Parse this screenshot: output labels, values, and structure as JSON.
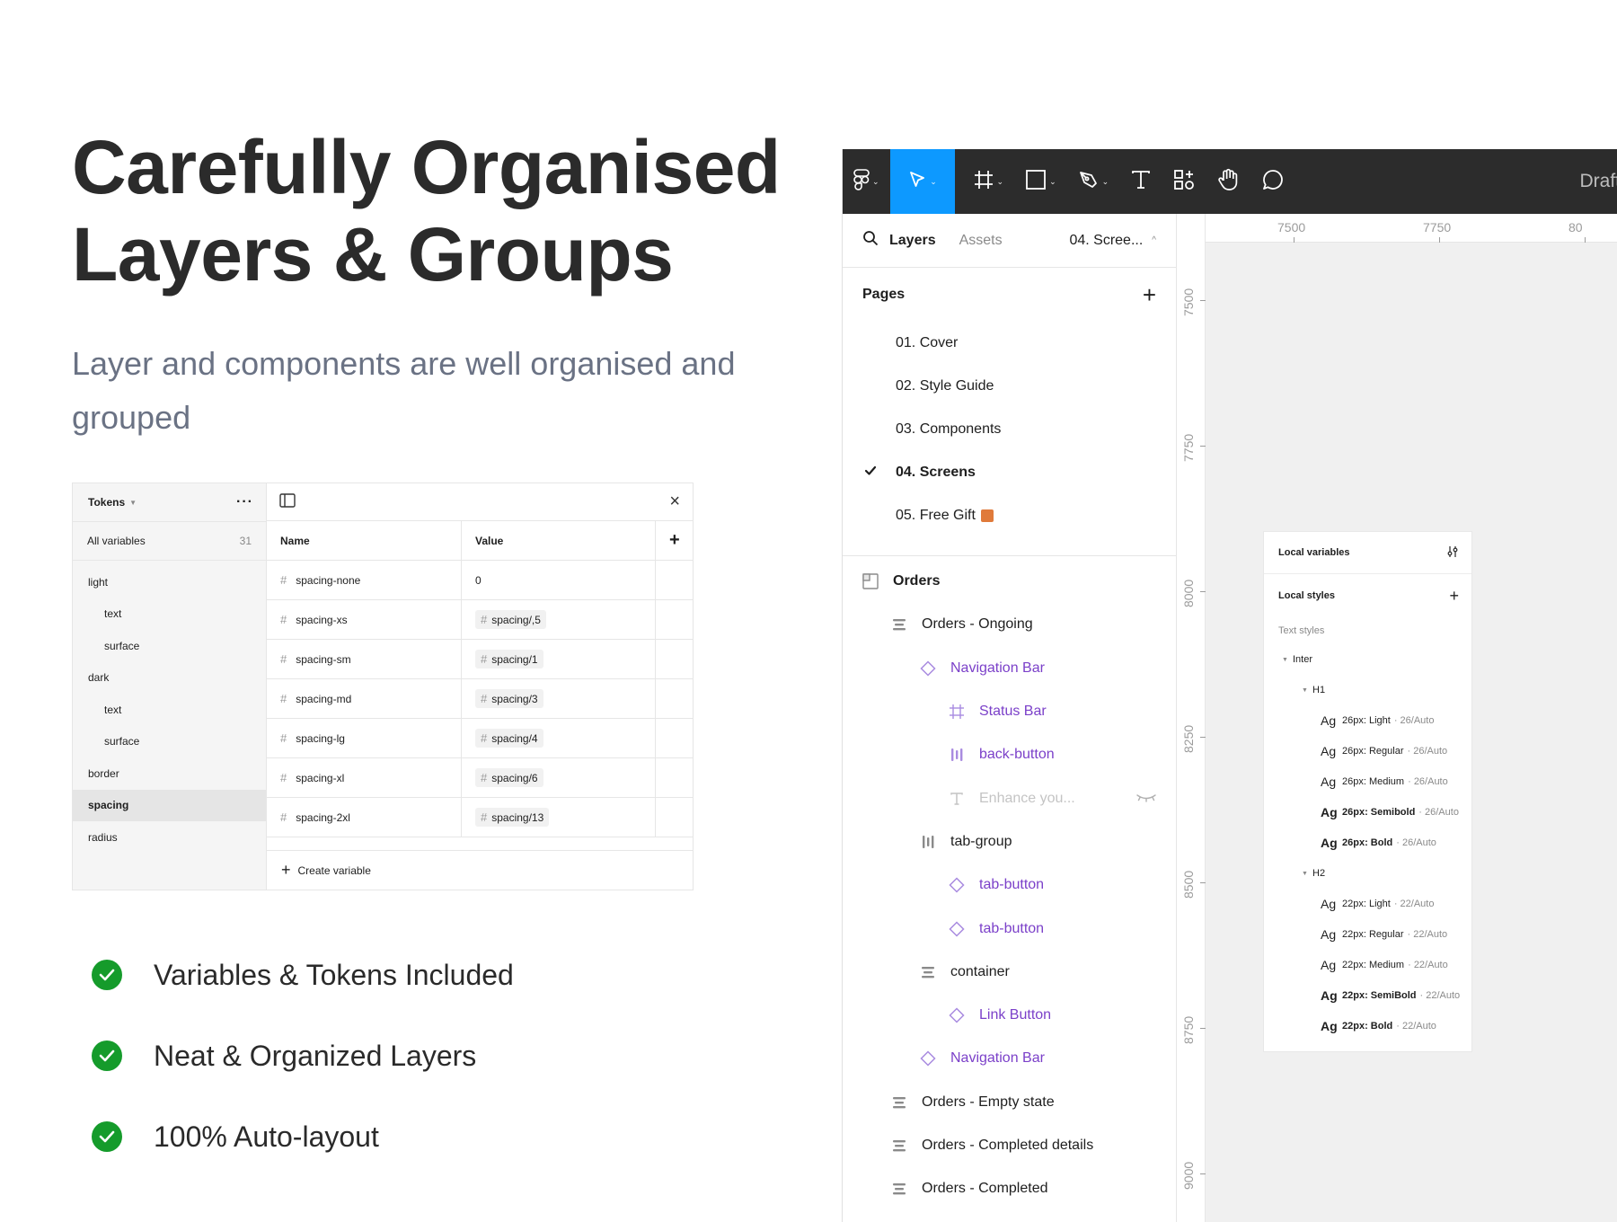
{
  "headline": {
    "line1": "Carefully Organised",
    "line2": "Layers & Groups"
  },
  "subline": "Layer and components are well organised and grouped",
  "tokens_panel": {
    "collection": "Tokens",
    "all_variables_label": "All variables",
    "all_variables_count": "31",
    "groups": [
      {
        "label": "light",
        "level": 0
      },
      {
        "label": "text",
        "level": 1
      },
      {
        "label": "surface",
        "level": 1
      },
      {
        "label": "dark",
        "level": 0
      },
      {
        "label": "text",
        "level": 1
      },
      {
        "label": "surface",
        "level": 1
      },
      {
        "label": "border",
        "level": 0
      },
      {
        "label": "spacing",
        "level": 0,
        "active": true
      },
      {
        "label": "radius",
        "level": 0
      }
    ],
    "columns": {
      "name": "Name",
      "value": "Value"
    },
    "rows": [
      {
        "name": "spacing-none",
        "value": "0",
        "alias": false
      },
      {
        "name": "spacing-xs",
        "value": "spacing/,5",
        "alias": true
      },
      {
        "name": "spacing-sm",
        "value": "spacing/1",
        "alias": true
      },
      {
        "name": "spacing-md",
        "value": "spacing/3",
        "alias": true
      },
      {
        "name": "spacing-lg",
        "value": "spacing/4",
        "alias": true
      },
      {
        "name": "spacing-xl",
        "value": "spacing/6",
        "alias": true
      },
      {
        "name": "spacing-2xl",
        "value": "spacing/13",
        "alias": true
      }
    ],
    "create_label": "Create variable"
  },
  "features": [
    "Variables & Tokens Included",
    "Neat & Organized Layers",
    "100% Auto-layout"
  ],
  "figma": {
    "toolbar_right_text": "Draft",
    "tools": [
      "figma-menu-icon",
      "move-icon",
      "frame-icon",
      "shape-icon",
      "pen-icon",
      "text-icon",
      "resources-icon",
      "hand-icon",
      "comment-icon"
    ],
    "tabs": {
      "layers": "Layers",
      "assets": "Assets",
      "current_page": "04. Scree..."
    },
    "pages_label": "Pages",
    "pages": [
      {
        "label": "01. Cover"
      },
      {
        "label": "02. Style Guide"
      },
      {
        "label": "03. Components"
      },
      {
        "label": "04. Screens",
        "current": true
      },
      {
        "label": "05. Free Gift"
      }
    ],
    "layers": [
      {
        "label": "Orders",
        "kind": "frame",
        "depth": 0
      },
      {
        "label": "Orders - Ongoing",
        "kind": "stack",
        "depth": 1
      },
      {
        "label": "Navigation Bar",
        "kind": "component",
        "depth": 2
      },
      {
        "label": "Status Bar",
        "kind": "component-frame",
        "depth": 3
      },
      {
        "label": "back-button",
        "kind": "component-hstack",
        "depth": 3
      },
      {
        "label": "Enhance you...",
        "kind": "text-hidden",
        "depth": 3
      },
      {
        "label": "tab-group",
        "kind": "hstack",
        "depth": 2
      },
      {
        "label": "tab-button",
        "kind": "component",
        "depth": 3
      },
      {
        "label": "tab-button",
        "kind": "component",
        "depth": 3
      },
      {
        "label": "container",
        "kind": "stack",
        "depth": 2
      },
      {
        "label": "Link Button",
        "kind": "component",
        "depth": 3
      },
      {
        "label": "Navigation Bar",
        "kind": "component",
        "depth": 2
      },
      {
        "label": "Orders - Empty state",
        "kind": "stack",
        "depth": 1
      },
      {
        "label": "Orders - Completed details",
        "kind": "stack",
        "depth": 1
      },
      {
        "label": "Orders - Completed",
        "kind": "stack",
        "depth": 1
      }
    ],
    "ruler_top": [
      "7500",
      "7750",
      "80"
    ],
    "ruler_left": [
      "7500",
      "7750",
      "8000",
      "8250",
      "8500",
      "8750",
      "9000"
    ],
    "local_panel": {
      "variables_label": "Local variables",
      "styles_label": "Local styles",
      "text_styles_label": "Text styles",
      "font_group": "Inter",
      "groups": [
        {
          "name": "H1",
          "styles": [
            {
              "name": "26px: Light",
              "meta": "26/Auto",
              "weight": 300
            },
            {
              "name": "26px: Regular",
              "meta": "26/Auto",
              "weight": 400
            },
            {
              "name": "26px: Medium",
              "meta": "26/Auto",
              "weight": 500
            },
            {
              "name": "26px: Semibold",
              "meta": "26/Auto",
              "weight": 600
            },
            {
              "name": "26px: Bold",
              "meta": "26/Auto",
              "weight": 700
            }
          ]
        },
        {
          "name": "H2",
          "styles": [
            {
              "name": "22px: Light",
              "meta": "22/Auto",
              "weight": 300
            },
            {
              "name": "22px: Regular",
              "meta": "22/Auto",
              "weight": 400
            },
            {
              "name": "22px: Medium",
              "meta": "22/Auto",
              "weight": 500
            },
            {
              "name": "22px: SemiBold",
              "meta": "22/Auto",
              "weight": 600
            },
            {
              "name": "22px: Bold",
              "meta": "22/Auto",
              "weight": 700
            }
          ]
        }
      ]
    }
  },
  "colors": {
    "accent_blue": "#0d99ff",
    "component_purple": "#7b40c9",
    "check_green": "#159b2b",
    "toolbar_dark": "#2c2c2c"
  }
}
